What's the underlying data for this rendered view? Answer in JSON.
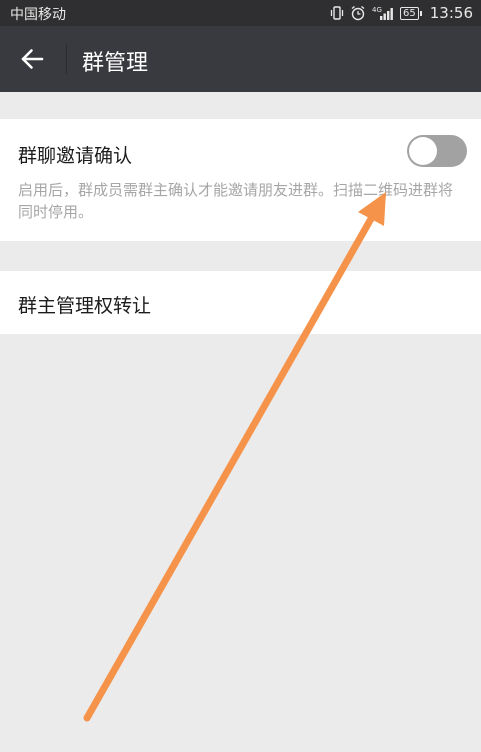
{
  "status_bar": {
    "carrier": "中国移动",
    "battery": "65",
    "time": "13:56",
    "icons": [
      "vibrate-icon",
      "alarm-icon",
      "signal-4g-icon",
      "battery-icon"
    ]
  },
  "header": {
    "title": "群管理",
    "back_icon": "arrow-left-icon"
  },
  "settings": {
    "invite_confirm": {
      "label": "群聊邀请确认",
      "description": "启用后，群成员需群主确认才能邀请朋友进群。扫描二维码进群将同时停用。",
      "enabled": false
    },
    "transfer_owner": {
      "label": "群主管理权转让"
    }
  },
  "colors": {
    "status_bar_bg": "#2f2f31",
    "header_bg": "#393a3f",
    "page_bg": "#ebebeb",
    "toggle_off": "#a2a2a2",
    "annotation_arrow": "#f5934a"
  }
}
